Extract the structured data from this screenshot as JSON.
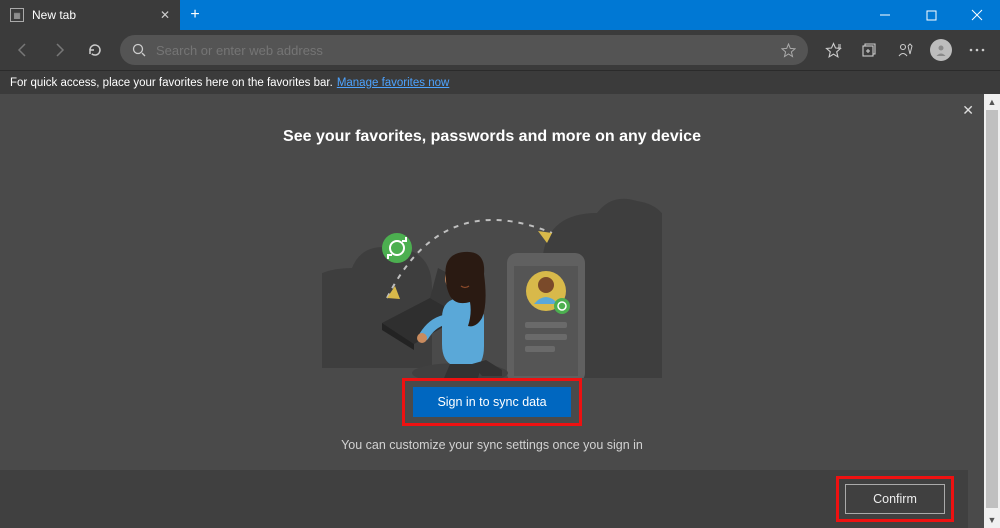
{
  "tab": {
    "title": "New tab"
  },
  "addressbar": {
    "placeholder": "Search or enter web address"
  },
  "favbar": {
    "text": "For quick access, place your favorites here on the favorites bar.",
    "link": "Manage favorites now"
  },
  "sync": {
    "heading": "See your favorites, passwords and more on any device",
    "button": "Sign in to sync data",
    "subtext": "You can customize your sync settings once you sign in"
  },
  "footer": {
    "confirm": "Confirm"
  }
}
